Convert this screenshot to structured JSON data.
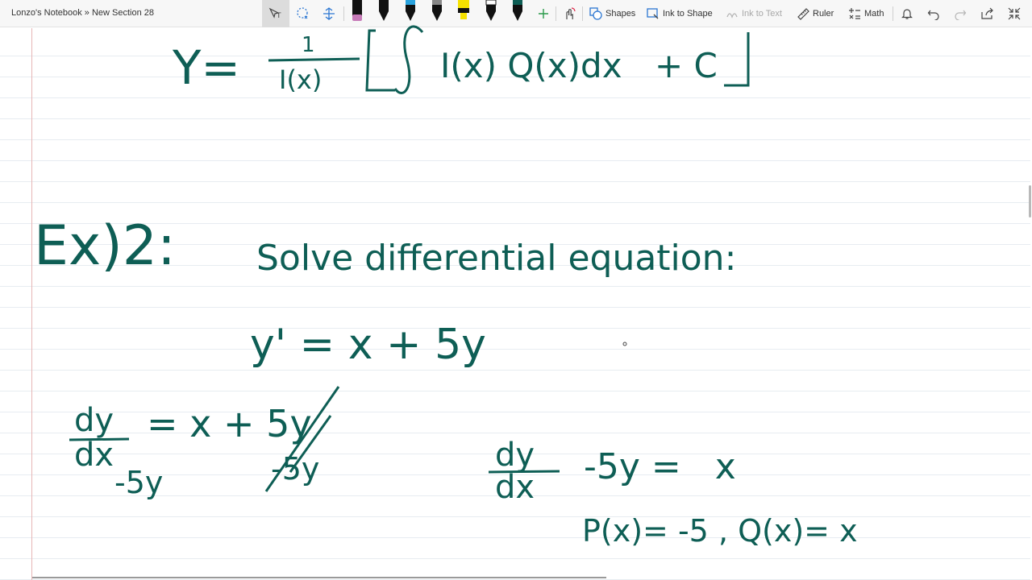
{
  "breadcrumb": "Lonzo's Notebook » New Section 28",
  "toolbar": {
    "shapes_label": "Shapes",
    "ink_to_shape_label": "Ink to Shape",
    "ink_to_text_label": "Ink to Text",
    "ruler_label": "Ruler",
    "math_label": "Math"
  },
  "colors": {
    "ink": "#0e5e55",
    "pen_highlighter": "#f5e100",
    "pen_accent_pink": "#c77ab8",
    "pen_accent_blue": "#2aa3de"
  },
  "ink": {
    "formula_y": "Y=",
    "formula_num": "1",
    "formula_den": "I(x)",
    "formula_integrand": "I(x) Q(x)dx",
    "formula_plus_c": "+ C",
    "ex_label": "Ex)2:",
    "solve_text": "Solve differential equation:",
    "equation": "y' = x + 5y",
    "dy": "dy",
    "dx": "dx",
    "eq_rhs": "= x + 5y",
    "minus5y_left": "-5y",
    "minus5y_right": "-5y",
    "std_rhs": "-5y =   x",
    "px_qx": "P(x)= -5 , Q(x)= x"
  }
}
